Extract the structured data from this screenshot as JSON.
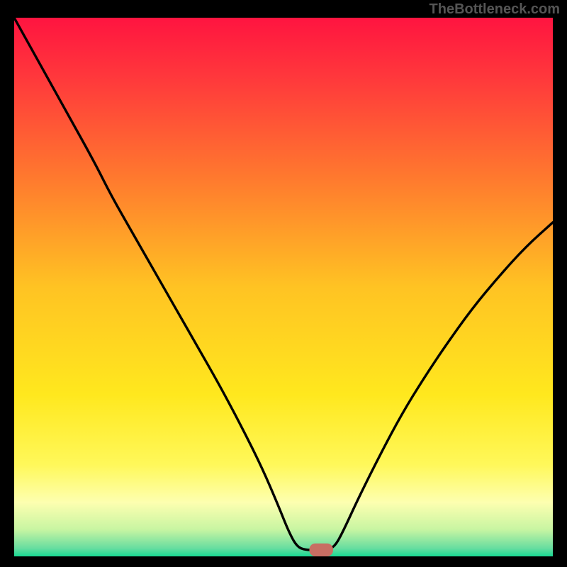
{
  "watermark": "TheBottleneck.com",
  "chart_data": {
    "type": "line",
    "title": "",
    "xlabel": "",
    "ylabel": "",
    "xlim": [
      0,
      100
    ],
    "ylim": [
      0,
      100
    ],
    "background_gradient": {
      "stops": [
        {
          "offset": 0.0,
          "color": "#ff1440"
        },
        {
          "offset": 0.12,
          "color": "#ff3b3b"
        },
        {
          "offset": 0.3,
          "color": "#ff7a2e"
        },
        {
          "offset": 0.5,
          "color": "#ffc323"
        },
        {
          "offset": 0.7,
          "color": "#ffe81e"
        },
        {
          "offset": 0.83,
          "color": "#fff85a"
        },
        {
          "offset": 0.9,
          "color": "#fdffb0"
        },
        {
          "offset": 0.95,
          "color": "#c8f5a2"
        },
        {
          "offset": 0.985,
          "color": "#67dda0"
        },
        {
          "offset": 1.0,
          "color": "#17d993"
        }
      ]
    },
    "series": [
      {
        "name": "bottleneck-curve",
        "values": [
          {
            "x": 0.0,
            "y": 100.0
          },
          {
            "x": 5.0,
            "y": 91.0
          },
          {
            "x": 10.0,
            "y": 82.0
          },
          {
            "x": 15.0,
            "y": 73.0
          },
          {
            "x": 18.0,
            "y": 67.0
          },
          {
            "x": 22.0,
            "y": 60.0
          },
          {
            "x": 26.0,
            "y": 53.0
          },
          {
            "x": 30.0,
            "y": 46.0
          },
          {
            "x": 34.0,
            "y": 39.0
          },
          {
            "x": 38.0,
            "y": 32.0
          },
          {
            "x": 42.0,
            "y": 24.5
          },
          {
            "x": 46.0,
            "y": 16.5
          },
          {
            "x": 49.0,
            "y": 9.5
          },
          {
            "x": 51.0,
            "y": 4.5
          },
          {
            "x": 52.5,
            "y": 1.8
          },
          {
            "x": 54.0,
            "y": 1.2
          },
          {
            "x": 56.0,
            "y": 1.2
          },
          {
            "x": 58.0,
            "y": 1.2
          },
          {
            "x": 59.5,
            "y": 1.8
          },
          {
            "x": 61.0,
            "y": 4.5
          },
          {
            "x": 64.0,
            "y": 11.0
          },
          {
            "x": 68.0,
            "y": 19.0
          },
          {
            "x": 72.0,
            "y": 26.5
          },
          {
            "x": 76.0,
            "y": 33.0
          },
          {
            "x": 80.0,
            "y": 39.0
          },
          {
            "x": 85.0,
            "y": 46.0
          },
          {
            "x": 90.0,
            "y": 52.0
          },
          {
            "x": 95.0,
            "y": 57.5
          },
          {
            "x": 100.0,
            "y": 62.0
          }
        ]
      }
    ],
    "marker": {
      "name": "optimal-point",
      "x": 57.0,
      "y": 1.2,
      "rx": 2.2,
      "ry": 1.2,
      "fill": "#c86e63"
    }
  }
}
